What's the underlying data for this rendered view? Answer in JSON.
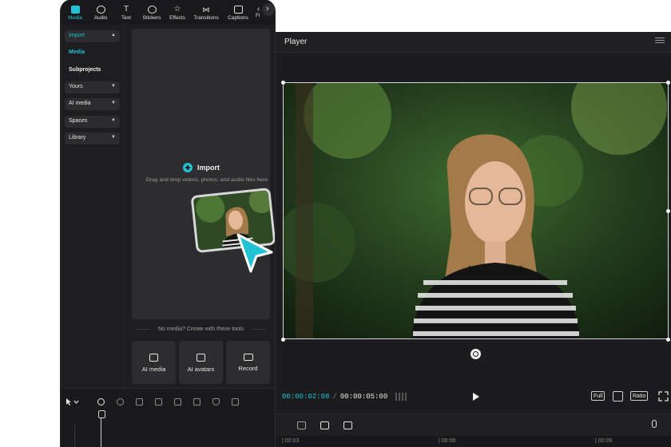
{
  "media_panel": {
    "tabs": [
      {
        "label": "Media",
        "icon": "media-icon",
        "active": true
      },
      {
        "label": "Audio",
        "icon": "audio-icon"
      },
      {
        "label": "Text",
        "icon": "text-icon"
      },
      {
        "label": "Stickers",
        "icon": "stickers-icon"
      },
      {
        "label": "Effects",
        "icon": "effects-icon"
      },
      {
        "label": "Transitions",
        "icon": "transitions-icon"
      },
      {
        "label": "Captions",
        "icon": "captions-icon"
      },
      {
        "label": "Fi",
        "icon": "filters-icon"
      }
    ],
    "sidebar": {
      "import": "Import",
      "media": "Media",
      "subprojects": "Subprojects",
      "yours": "Yours",
      "ai_media": "AI media",
      "spaces": "Spaces",
      "library": "Library"
    },
    "dropzone": {
      "import_label": "Import",
      "hint": "Drag and drop videos, photos, and audio files here"
    },
    "no_media_text": "No media? Create with these tools",
    "tools": [
      {
        "label": "AI media",
        "icon": "ai-media-icon"
      },
      {
        "label": "AI avatars",
        "icon": "ai-avatars-icon"
      },
      {
        "label": "Record",
        "icon": "record-icon"
      }
    ]
  },
  "player": {
    "title": "Player",
    "current_time": "00:00:02:08",
    "separator": "/",
    "total_time": "00:00:05:00",
    "buttons": {
      "full": "Full",
      "ratio": "Ratio"
    }
  },
  "timeline": {
    "ruler_marks": [
      "| 00:03",
      "| 00:06",
      "| 00:09"
    ]
  },
  "colors": {
    "accent": "#21c2d3",
    "panel_bg": "#1e1e20",
    "card_bg": "#2d2d2f"
  }
}
